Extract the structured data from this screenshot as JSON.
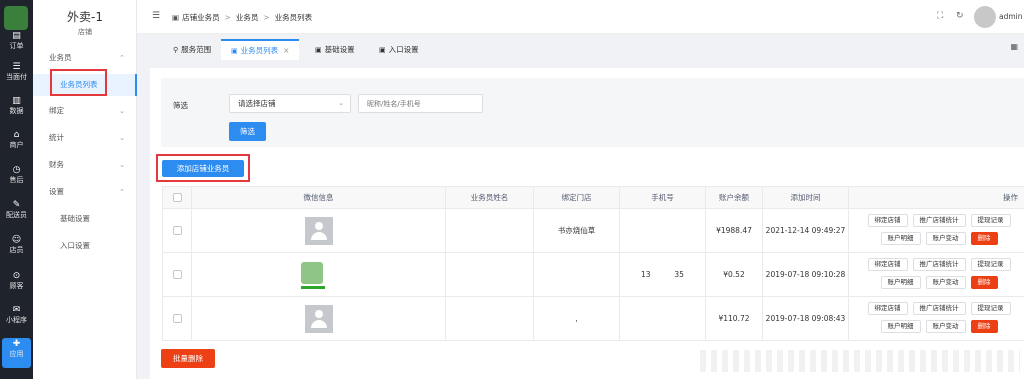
{
  "rail": {
    "items": [
      {
        "label": "订单",
        "icon": "orders-icon",
        "glyph": "▤"
      },
      {
        "label": "当面付",
        "icon": "list-icon",
        "glyph": "☰"
      },
      {
        "label": "数据",
        "icon": "bar-chart-icon",
        "glyph": "▥"
      },
      {
        "label": "商户",
        "icon": "shop-icon",
        "glyph": "⌂"
      },
      {
        "label": "售后",
        "icon": "clock-icon",
        "glyph": "◷"
      },
      {
        "label": "配送员",
        "icon": "scooter-icon",
        "glyph": "✎"
      },
      {
        "label": "店员",
        "icon": "people-icon",
        "glyph": "☺"
      },
      {
        "label": "顾客",
        "icon": "compass-icon",
        "glyph": "⊙"
      },
      {
        "label": "小程序",
        "icon": "chat-icon",
        "glyph": "✉"
      },
      {
        "label": "应用",
        "icon": "apps-icon",
        "glyph": "✚"
      }
    ]
  },
  "side": {
    "store_name": "外卖-1",
    "store_sub": "店铺",
    "groups": [
      {
        "label": "业务员",
        "chev": "⌃"
      },
      {
        "label": "绑定",
        "chev": "⌄"
      },
      {
        "label": "统计",
        "chev": "⌄"
      },
      {
        "label": "财务",
        "chev": "⌄"
      },
      {
        "label": "设置",
        "chev": "⌃"
      }
    ],
    "subs": [
      {
        "label": "业务员列表"
      },
      {
        "label": "基础设置"
      },
      {
        "label": "入口设置"
      }
    ]
  },
  "header": {
    "breadcrumb": [
      "店铺业务员",
      "业务员",
      "业务员列表"
    ],
    "user": "admin ∨"
  },
  "tabs": [
    {
      "label": "服务范围",
      "icon": "⚲"
    },
    {
      "label": "业务员列表",
      "icon": "▣",
      "close": "×"
    },
    {
      "label": "基础设置",
      "icon": "▣"
    },
    {
      "label": "入口设置",
      "icon": "▣"
    }
  ],
  "filter": {
    "label": "筛选",
    "store_select": "请选择店铺",
    "search_placeholder": "昵称/姓名/手机号",
    "submit": "筛选"
  },
  "actions": {
    "add_salesman": "添加店铺业务员",
    "bulk_delete": "批量删除"
  },
  "table": {
    "headers": [
      "微信信息",
      "业务员姓名",
      "绑定门店",
      "手机号",
      "账户余额",
      "添加时间",
      "操作"
    ],
    "op_labels": {
      "bind_store": "绑定店铺",
      "promo_stats": "推广店铺统计",
      "withdraw_log": "提现记录",
      "account_detail": "账户明细",
      "account_change": "账户变动",
      "delete": "删除"
    },
    "rows": [
      {
        "name": "",
        "store": "书亦烧仙草",
        "phone": "",
        "balance": "¥1988.47",
        "time": "2021-12-14 09:49:27"
      },
      {
        "name": "",
        "store": "",
        "phone": "13          35",
        "balance": "¥0.52",
        "time": "2019-07-18 09:10:28"
      },
      {
        "name": "",
        "store": ",",
        "phone": "",
        "balance": "¥110.72",
        "time": "2019-07-18 09:08:43"
      }
    ]
  },
  "colors": {
    "primary": "#2d8cf0",
    "danger": "#ed4014",
    "highlight_box": "#e4393c"
  }
}
